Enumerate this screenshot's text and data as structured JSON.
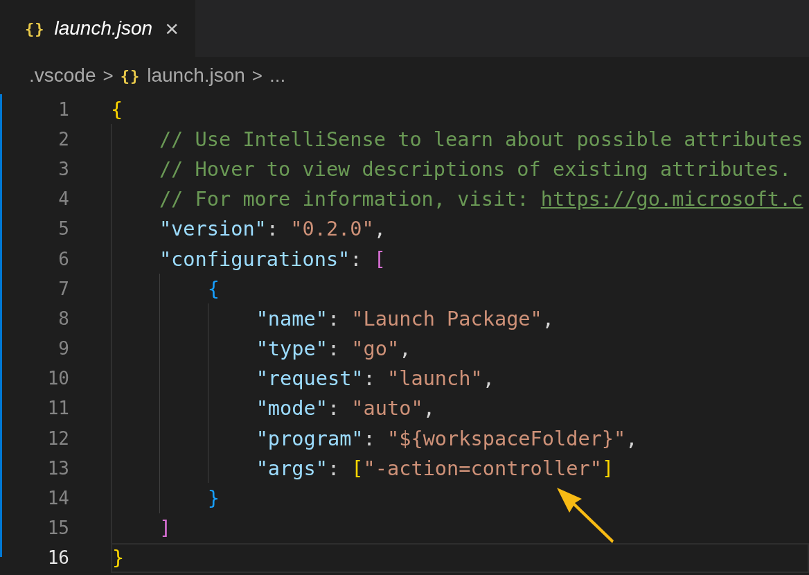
{
  "tabs": [
    {
      "icon": "{}",
      "label": "launch.json",
      "close": "×",
      "selected": true,
      "preview": true
    }
  ],
  "breadcrumb": [
    {
      "kind": "folder",
      "text": ".vscode"
    },
    {
      "kind": "sep",
      "text": ">"
    },
    {
      "kind": "file",
      "icon": "{}",
      "text": "launch.json"
    },
    {
      "kind": "sep",
      "text": ">"
    },
    {
      "kind": "more",
      "text": "..."
    }
  ],
  "lines": [
    {
      "number": "1",
      "current": false,
      "tokens": [
        {
          "kind": "bracket1",
          "text": "{"
        }
      ]
    },
    {
      "number": "2",
      "current": false,
      "tokens": [
        {
          "kind": "comment",
          "text": "    // Use IntelliSense to learn about possible attributes"
        }
      ]
    },
    {
      "number": "3",
      "current": false,
      "tokens": [
        {
          "kind": "comment",
          "text": "    // Hover to view descriptions of existing attributes."
        }
      ]
    },
    {
      "number": "4",
      "current": false,
      "tokens": [
        {
          "kind": "comment",
          "text": "    // For more information, visit: "
        },
        {
          "kind": "link",
          "text": "https://go.microsoft.c"
        }
      ]
    },
    {
      "number": "5",
      "current": false,
      "tokens": [
        {
          "kind": "key",
          "text": "    \"version\""
        },
        {
          "kind": "punct",
          "text": ": "
        },
        {
          "kind": "string",
          "text": "\"0.2.0\""
        },
        {
          "kind": "punct",
          "text": ","
        }
      ]
    },
    {
      "number": "6",
      "current": false,
      "tokens": [
        {
          "kind": "key",
          "text": "    \"configurations\""
        },
        {
          "kind": "punct",
          "text": ": "
        },
        {
          "kind": "bracket2",
          "text": "["
        }
      ]
    },
    {
      "number": "7",
      "current": false,
      "tokens": [
        {
          "kind": "bracket3",
          "text": "        {"
        }
      ]
    },
    {
      "number": "8",
      "current": false,
      "tokens": [
        {
          "kind": "key",
          "text": "            \"name\""
        },
        {
          "kind": "punct",
          "text": ": "
        },
        {
          "kind": "string",
          "text": "\"Launch Package\""
        },
        {
          "kind": "punct",
          "text": ","
        }
      ]
    },
    {
      "number": "9",
      "current": false,
      "tokens": [
        {
          "kind": "key",
          "text": "            \"type\""
        },
        {
          "kind": "punct",
          "text": ": "
        },
        {
          "kind": "string",
          "text": "\"go\""
        },
        {
          "kind": "punct",
          "text": ","
        }
      ]
    },
    {
      "number": "10",
      "current": false,
      "tokens": [
        {
          "kind": "key",
          "text": "            \"request\""
        },
        {
          "kind": "punct",
          "text": ": "
        },
        {
          "kind": "string",
          "text": "\"launch\""
        },
        {
          "kind": "punct",
          "text": ","
        }
      ]
    },
    {
      "number": "11",
      "current": false,
      "tokens": [
        {
          "kind": "key",
          "text": "            \"mode\""
        },
        {
          "kind": "punct",
          "text": ": "
        },
        {
          "kind": "string",
          "text": "\"auto\""
        },
        {
          "kind": "punct",
          "text": ","
        }
      ]
    },
    {
      "number": "12",
      "current": false,
      "tokens": [
        {
          "kind": "key",
          "text": "            \"program\""
        },
        {
          "kind": "punct",
          "text": ": "
        },
        {
          "kind": "string",
          "text": "\"${workspaceFolder}\""
        },
        {
          "kind": "punct",
          "text": ","
        }
      ]
    },
    {
      "number": "13",
      "current": false,
      "tokens": [
        {
          "kind": "key",
          "text": "            \"args\""
        },
        {
          "kind": "punct",
          "text": ": "
        },
        {
          "kind": "bracket1",
          "text": "["
        },
        {
          "kind": "string",
          "text": "\"-action=controller\""
        },
        {
          "kind": "bracket1",
          "text": "]"
        }
      ]
    },
    {
      "number": "14",
      "current": false,
      "tokens": [
        {
          "kind": "bracket3",
          "text": "        }"
        }
      ]
    },
    {
      "number": "15",
      "current": false,
      "tokens": [
        {
          "kind": "bracket2",
          "text": "    ]"
        }
      ]
    },
    {
      "number": "16",
      "current": true,
      "tokens": [
        {
          "kind": "bracket1",
          "text": "}"
        }
      ]
    }
  ]
}
